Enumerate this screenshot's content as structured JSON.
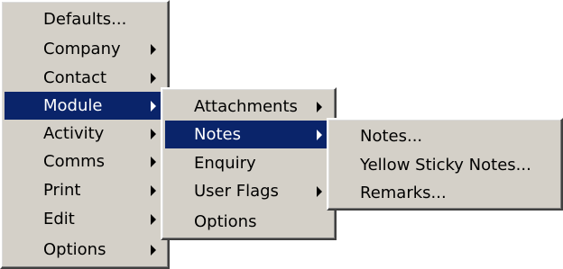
{
  "main_menu": {
    "items": [
      {
        "label": "Defaults...",
        "submenu": false,
        "selected": false
      },
      {
        "label": "Company",
        "submenu": true,
        "selected": false
      },
      {
        "label": "Contact",
        "submenu": true,
        "selected": false
      },
      {
        "label": "Module",
        "submenu": true,
        "selected": true
      },
      {
        "label": "Activity",
        "submenu": true,
        "selected": false
      },
      {
        "label": "Comms",
        "submenu": true,
        "selected": false
      },
      {
        "label": "Print",
        "submenu": true,
        "selected": false
      },
      {
        "label": "Edit",
        "submenu": true,
        "selected": false
      },
      {
        "label": "Options",
        "submenu": true,
        "selected": false
      }
    ]
  },
  "module_submenu": {
    "items": [
      {
        "label": "Attachments",
        "submenu": true,
        "selected": false
      },
      {
        "label": "Notes",
        "submenu": true,
        "selected": true
      },
      {
        "label": "Enquiry",
        "submenu": false,
        "selected": false
      },
      {
        "label": "User Flags",
        "submenu": true,
        "selected": false
      },
      {
        "label": "Options",
        "submenu": false,
        "selected": false
      }
    ]
  },
  "notes_submenu": {
    "items": [
      {
        "label": "Notes...",
        "submenu": false,
        "selected": false
      },
      {
        "label": "Yellow Sticky Notes...",
        "submenu": false,
        "selected": false
      },
      {
        "label": "Remarks...",
        "submenu": false,
        "selected": false
      }
    ]
  },
  "colors": {
    "menu_background": "#d4d0c8",
    "selection_background": "#0a246a",
    "selection_text": "#ffffff",
    "text": "#000000"
  }
}
